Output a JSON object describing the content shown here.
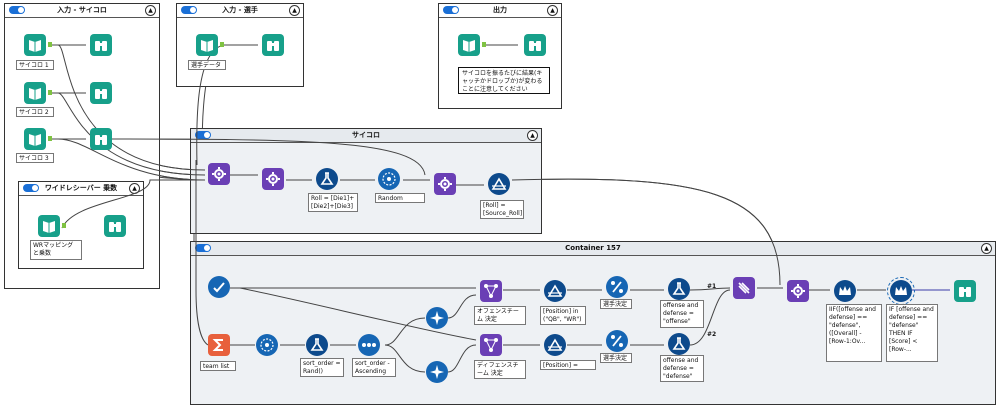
{
  "containers": {
    "input_dice": "入力 - サイコロ",
    "input_player": "入力 - 選手",
    "output": "出力",
    "wide_receiver": "ワイドレシーバー 乗数",
    "dice": "サイコロ",
    "container157": "Container 157"
  },
  "collapse_icon": "▲",
  "labels": {
    "dice1": "サイコロ 1",
    "dice2": "サイコロ 2",
    "dice3": "サイコロ 3",
    "player_data": "選手データ",
    "wr_mapping": "WRマッピングと乗数",
    "roll_formula": "Roll = [Die1]+[Die2]+[Die3]",
    "random_record": "Random Record",
    "roll_filter": "[Roll] = [Source_Roll]",
    "team_list": "team list",
    "sort_order": "sort_order = Rand()",
    "sort_order_asc": "sort_order - Ascending",
    "offense_team": "オフェンスチーム 決定",
    "defense_team": "ディフェンスチーム 決定",
    "position_qb_wr": "[Position] in (\"QB\", \"WR\")",
    "position_cb": "[Position] = \"CB\"",
    "player_decide1": "選手決定",
    "player_decide2": "選手決定",
    "offense_formula": "offense and defense = \"offense\"",
    "defense_formula": "offense and defense = \"defense\"",
    "iif_formula": "IIF([offense and defense] == \"defense\", ([Overall] - [Row-1:Ov...",
    "if_formula": "IF [offense and defense] == \"defense\" THEN IF [Score] < [Row-...",
    "anchor1": "#1",
    "anchor2": "#2"
  },
  "comment": "サイコロを振るたびに結果(キャッチかドロップか)が変わることに注意してください",
  "icons": [
    "book-icon",
    "binoculars-icon",
    "join-icon",
    "flask-icon",
    "random-icon",
    "delta-icon",
    "checkmark-icon",
    "sigma-icon",
    "dots-icon",
    "compass-icon",
    "network-icon",
    "percent-icon",
    "chain-icon",
    "crown-icon"
  ],
  "colors": {
    "teal": "#17a08a",
    "purple": "#6a3fb5",
    "navy": "#0d4a8c",
    "orange": "#e8603c",
    "connector": "#7fc242",
    "toggle": "#1a6fd6"
  }
}
